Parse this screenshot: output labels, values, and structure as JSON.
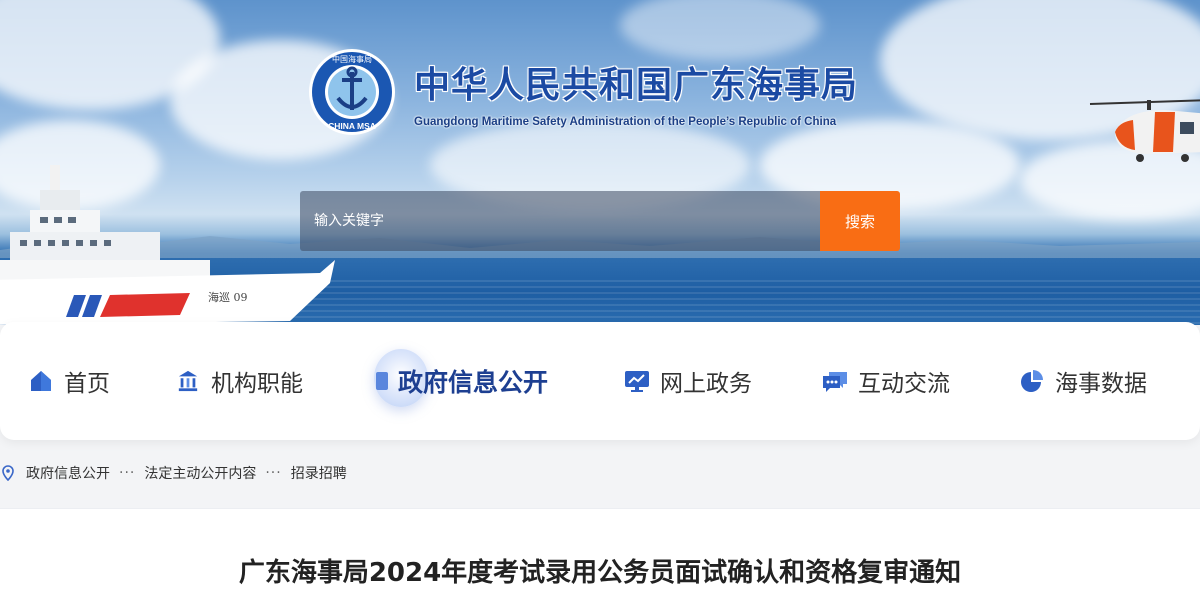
{
  "header": {
    "title_cn": "中华人民共和国广东海事局",
    "title_en": "Guangdong Maritime Safety Administration of the People’s Republic of China",
    "emblem_text_top": "中国海事局",
    "emblem_text_bottom": "CHINA MSA",
    "ship_marking": "海巡 09"
  },
  "search": {
    "placeholder": "输入关键字",
    "button_label": "搜索",
    "button_color": "#f96d14"
  },
  "nav": {
    "items": [
      {
        "label": "首页",
        "icon": "home-icon"
      },
      {
        "label": "机构职能",
        "icon": "institution-icon"
      },
      {
        "label": "政府信息公开",
        "icon": "document-icon",
        "active": true
      },
      {
        "label": "网上政务",
        "icon": "monitor-icon"
      },
      {
        "label": "互动交流",
        "icon": "chat-icon"
      },
      {
        "label": "海事数据",
        "icon": "pie-chart-icon"
      }
    ],
    "active_color": "#1d3f91"
  },
  "breadcrumb": {
    "items": [
      "政府信息公开",
      "法定主动公开内容",
      "招录招聘"
    ],
    "separator": "···"
  },
  "article": {
    "title": "广东海事局2024年度考试录用公务员面试确认和资格复审通知"
  }
}
